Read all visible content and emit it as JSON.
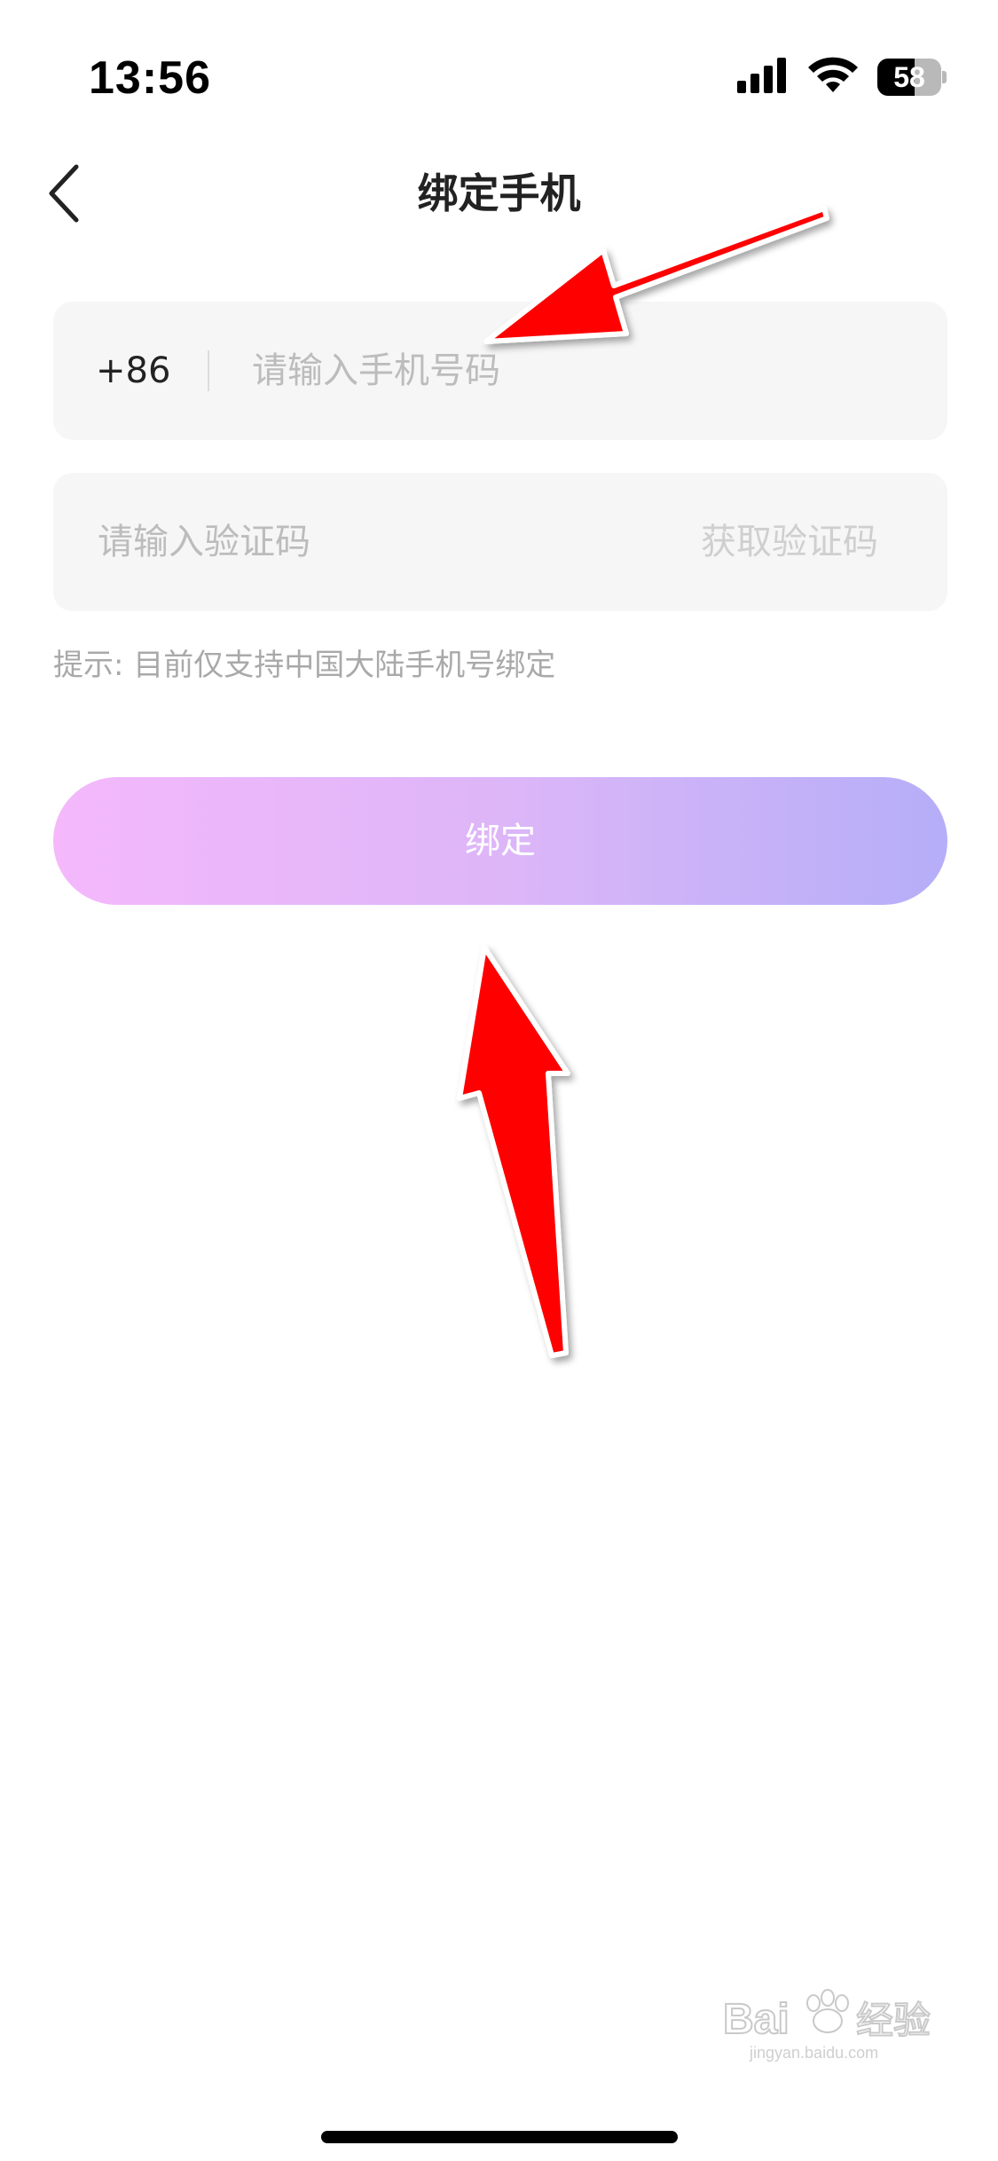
{
  "status_bar": {
    "time": "13:56",
    "battery_level": "58",
    "battery_fraction": 0.58
  },
  "nav": {
    "title": "绑定手机"
  },
  "phone_field": {
    "country_code": "+86",
    "placeholder": "请输入手机号码"
  },
  "code_field": {
    "placeholder": "请输入验证码",
    "get_code_label": "获取验证码"
  },
  "hint": "提示: 目前仅支持中国大陆手机号绑定",
  "bind_button": {
    "label": "绑定",
    "gradient": [
      "#f4b8fb",
      "#ddb6f8",
      "#b5aef8"
    ]
  },
  "colors": {
    "annotation_arrow": "#ff0000",
    "field_background": "#f6f6f6",
    "placeholder_text": "#bcbcbc"
  },
  "watermark": {
    "text": "Bai 经验",
    "subtext": "jingyan.baidu.com"
  }
}
